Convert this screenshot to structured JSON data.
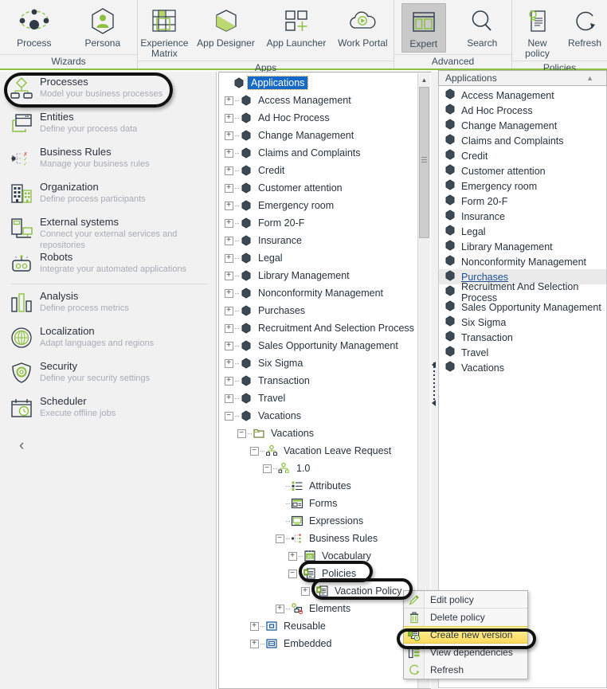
{
  "ribbon": {
    "groups": [
      {
        "name": "Wizards",
        "label": "Wizards",
        "items": [
          {
            "label": "Process",
            "icon": "process-wizard-icon",
            "active": false
          },
          {
            "label": "Persona",
            "icon": "persona-icon",
            "active": false
          }
        ]
      },
      {
        "name": "Apps",
        "label": "Apps",
        "items": [
          {
            "label": "Experience Matrix",
            "icon": "experience-matrix-icon",
            "active": false
          },
          {
            "label": "App Designer",
            "icon": "app-designer-icon",
            "active": false
          },
          {
            "label": "App Launcher",
            "icon": "app-launcher-icon",
            "active": false
          },
          {
            "label": "Work Portal",
            "icon": "work-portal-icon",
            "active": false
          }
        ]
      },
      {
        "name": "Advanced",
        "label": "Advanced",
        "items": [
          {
            "label": "Expert",
            "icon": "expert-view-icon",
            "active": true
          },
          {
            "label": "Search",
            "icon": "search-icon",
            "active": false
          }
        ]
      },
      {
        "name": "Policies",
        "label": "Policies",
        "items": [
          {
            "label": "New policy",
            "icon": "new-policy-icon",
            "active": false
          },
          {
            "label": "Refresh",
            "icon": "refresh-icon",
            "active": false
          }
        ]
      }
    ]
  },
  "sidebar": {
    "items": [
      {
        "title": "Processes",
        "subtitle": "Model your business processes",
        "icon": "processes-icon",
        "selected": true
      },
      {
        "title": "Entities",
        "subtitle": "Define your process data",
        "icon": "entities-icon",
        "selected": false
      },
      {
        "title": "Business Rules",
        "subtitle": "Manage your business rules",
        "icon": "business-rules-icon",
        "selected": false
      },
      {
        "title": "Organization",
        "subtitle": "Define process participants",
        "icon": "organization-icon",
        "selected": false
      },
      {
        "title": "External systems",
        "subtitle": "Connect your external services and repositories",
        "icon": "external-systems-icon",
        "selected": false
      },
      {
        "title": "Robots",
        "subtitle": "Integrate your automated applications",
        "icon": "robots-icon",
        "selected": false
      },
      {
        "title": "Analysis",
        "subtitle": "Define  process  metrics",
        "icon": "analysis-icon",
        "selected": false
      },
      {
        "title": "Localization",
        "subtitle": "Adapt  languages  and regions",
        "icon": "localization-icon",
        "selected": false
      },
      {
        "title": "Security",
        "subtitle": "Define  your  security  settings",
        "icon": "security-icon",
        "selected": false
      },
      {
        "title": "Scheduler",
        "subtitle": "Execute offline  jobs",
        "icon": "scheduler-icon",
        "selected": false
      }
    ],
    "collapse_glyph": "‹"
  },
  "tree": {
    "root": {
      "label": "Applications",
      "icon": "application-node-icon",
      "selected": true
    },
    "nodes": [
      {
        "label": "Access Management",
        "depth": 1,
        "expander": "+",
        "icon": "application-node-icon"
      },
      {
        "label": "Ad Hoc Process",
        "depth": 1,
        "expander": "+",
        "icon": "application-node-icon"
      },
      {
        "label": "Change Management",
        "depth": 1,
        "expander": "+",
        "icon": "application-node-icon"
      },
      {
        "label": "Claims and Complaints",
        "depth": 1,
        "expander": "+",
        "icon": "application-node-icon"
      },
      {
        "label": "Credit",
        "depth": 1,
        "expander": "+",
        "icon": "application-node-icon"
      },
      {
        "label": "Customer attention",
        "depth": 1,
        "expander": "+",
        "icon": "application-node-icon"
      },
      {
        "label": "Emergency room",
        "depth": 1,
        "expander": "+",
        "icon": "application-node-icon"
      },
      {
        "label": "Form 20-F",
        "depth": 1,
        "expander": "+",
        "icon": "application-node-icon"
      },
      {
        "label": "Insurance",
        "depth": 1,
        "expander": "+",
        "icon": "application-node-icon"
      },
      {
        "label": "Legal",
        "depth": 1,
        "expander": "+",
        "icon": "application-node-icon"
      },
      {
        "label": "Library Management",
        "depth": 1,
        "expander": "+",
        "icon": "application-node-icon"
      },
      {
        "label": "Nonconformity Management",
        "depth": 1,
        "expander": "+",
        "icon": "application-node-icon"
      },
      {
        "label": "Purchases",
        "depth": 1,
        "expander": "+",
        "icon": "application-node-icon"
      },
      {
        "label": "Recruitment And Selection Process",
        "depth": 1,
        "expander": "+",
        "icon": "application-node-icon"
      },
      {
        "label": "Sales Opportunity Management",
        "depth": 1,
        "expander": "+",
        "icon": "application-node-icon"
      },
      {
        "label": "Six Sigma",
        "depth": 1,
        "expander": "+",
        "icon": "application-node-icon"
      },
      {
        "label": "Transaction",
        "depth": 1,
        "expander": "+",
        "icon": "application-node-icon"
      },
      {
        "label": "Travel",
        "depth": 1,
        "expander": "+",
        "icon": "application-node-icon"
      },
      {
        "label": "Vacations",
        "depth": 1,
        "expander": "−",
        "icon": "application-node-icon"
      },
      {
        "label": "Vacations",
        "depth": 2,
        "expander": "−",
        "icon": "folder-icon"
      },
      {
        "label": "Vacation Leave Request",
        "depth": 3,
        "expander": "−",
        "icon": "process-node-icon"
      },
      {
        "label": "1.0",
        "depth": 4,
        "expander": "−",
        "icon": "process-version-icon"
      },
      {
        "label": "Attributes",
        "depth": 5,
        "expander": "",
        "icon": "attributes-icon"
      },
      {
        "label": "Forms",
        "depth": 5,
        "expander": "",
        "icon": "forms-icon"
      },
      {
        "label": "Expressions",
        "depth": 5,
        "expander": "",
        "icon": "expressions-icon"
      },
      {
        "label": "Business Rules",
        "depth": 5,
        "expander": "−",
        "icon": "business-rules-node-icon"
      },
      {
        "label": "Vocabulary",
        "depth": 6,
        "expander": "+",
        "icon": "vocabulary-icon"
      },
      {
        "label": "Policies",
        "depth": 6,
        "expander": "−",
        "icon": "policy-icon"
      },
      {
        "label": "Vacation Policy",
        "depth": 7,
        "expander": "+",
        "icon": "policy-icon"
      },
      {
        "label": "Elements",
        "depth": 5,
        "expander": "+",
        "icon": "elements-icon"
      },
      {
        "label": "Reusable",
        "depth": 3,
        "expander": "+",
        "icon": "reusable-icon"
      },
      {
        "label": "Embedded",
        "depth": 3,
        "expander": "+",
        "icon": "embedded-icon"
      }
    ]
  },
  "right_panel": {
    "header": "Applications",
    "sort_glyph": "▲",
    "items": [
      {
        "label": "Access Management",
        "hover": false
      },
      {
        "label": "Ad Hoc Process",
        "hover": false
      },
      {
        "label": "Change Management",
        "hover": false
      },
      {
        "label": "Claims and Complaints",
        "hover": false
      },
      {
        "label": "Credit",
        "hover": false
      },
      {
        "label": "Customer attention",
        "hover": false
      },
      {
        "label": "Emergency room",
        "hover": false
      },
      {
        "label": "Form 20-F",
        "hover": false
      },
      {
        "label": "Insurance",
        "hover": false
      },
      {
        "label": "Legal",
        "hover": false
      },
      {
        "label": "Library Management",
        "hover": false
      },
      {
        "label": "Nonconformity Management",
        "hover": false
      },
      {
        "label": "Purchases",
        "hover": true
      },
      {
        "label": "Recruitment And Selection Process",
        "hover": false
      },
      {
        "label": "Sales Opportunity Management",
        "hover": false
      },
      {
        "label": "Six Sigma",
        "hover": false
      },
      {
        "label": "Transaction",
        "hover": false
      },
      {
        "label": "Travel",
        "hover": false
      },
      {
        "label": "Vacations",
        "hover": false
      }
    ]
  },
  "context_menu": {
    "items": [
      {
        "label": "Edit policy",
        "icon": "pencil-icon",
        "highlighted": false
      },
      {
        "label": "Delete policy",
        "icon": "trash-icon",
        "highlighted": false
      },
      {
        "label": "Create new version",
        "icon": "new-version-icon",
        "highlighted": true
      },
      {
        "label": "View dependencies",
        "icon": "dependencies-icon",
        "highlighted": false
      },
      {
        "label": "Refresh",
        "icon": "refresh-icon",
        "highlighted": false
      }
    ]
  },
  "colors": {
    "accent_green": "#8cbf3f",
    "dark_slate": "#2f3b46",
    "selection_blue": "#1669c7",
    "highlight_yellow": "#fdd95c",
    "annotation_black": "#111111"
  }
}
